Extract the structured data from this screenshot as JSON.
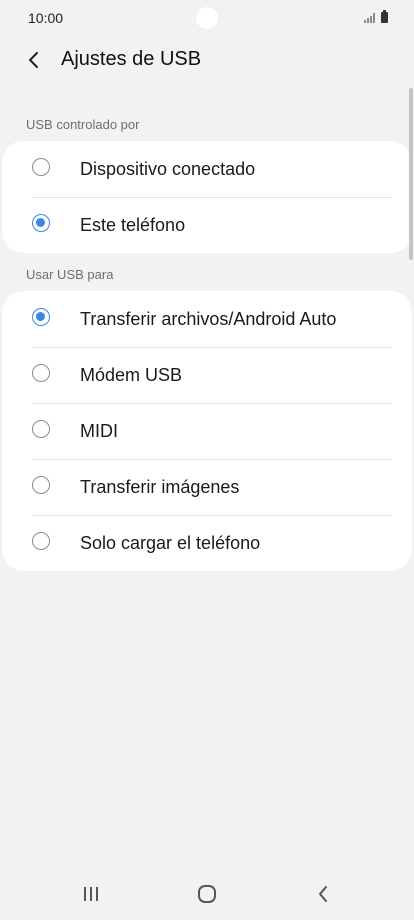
{
  "status_bar": {
    "time": "10:00"
  },
  "header": {
    "back_icon": "chevron-left-icon",
    "title": "Ajustes de USB"
  },
  "sections": [
    {
      "label": "USB controlado por",
      "options": [
        {
          "label": "Dispositivo conectado",
          "selected": false
        },
        {
          "label": "Este teléfono",
          "selected": true
        }
      ]
    },
    {
      "label": "Usar USB para",
      "options": [
        {
          "label": "Transferir archivos/Android Auto",
          "selected": true
        },
        {
          "label": "Módem USB",
          "selected": false
        },
        {
          "label": "MIDI",
          "selected": false
        },
        {
          "label": "Transferir imágenes",
          "selected": false
        },
        {
          "label": "Solo cargar el teléfono",
          "selected": false
        }
      ]
    }
  ],
  "nav_bar": {
    "recents_icon": "recents-icon",
    "home_icon": "home-icon",
    "back_icon": "back-icon"
  },
  "colors": {
    "accent": "#3e85ea",
    "background": "#f2f2f2",
    "card": "#ffffff"
  }
}
